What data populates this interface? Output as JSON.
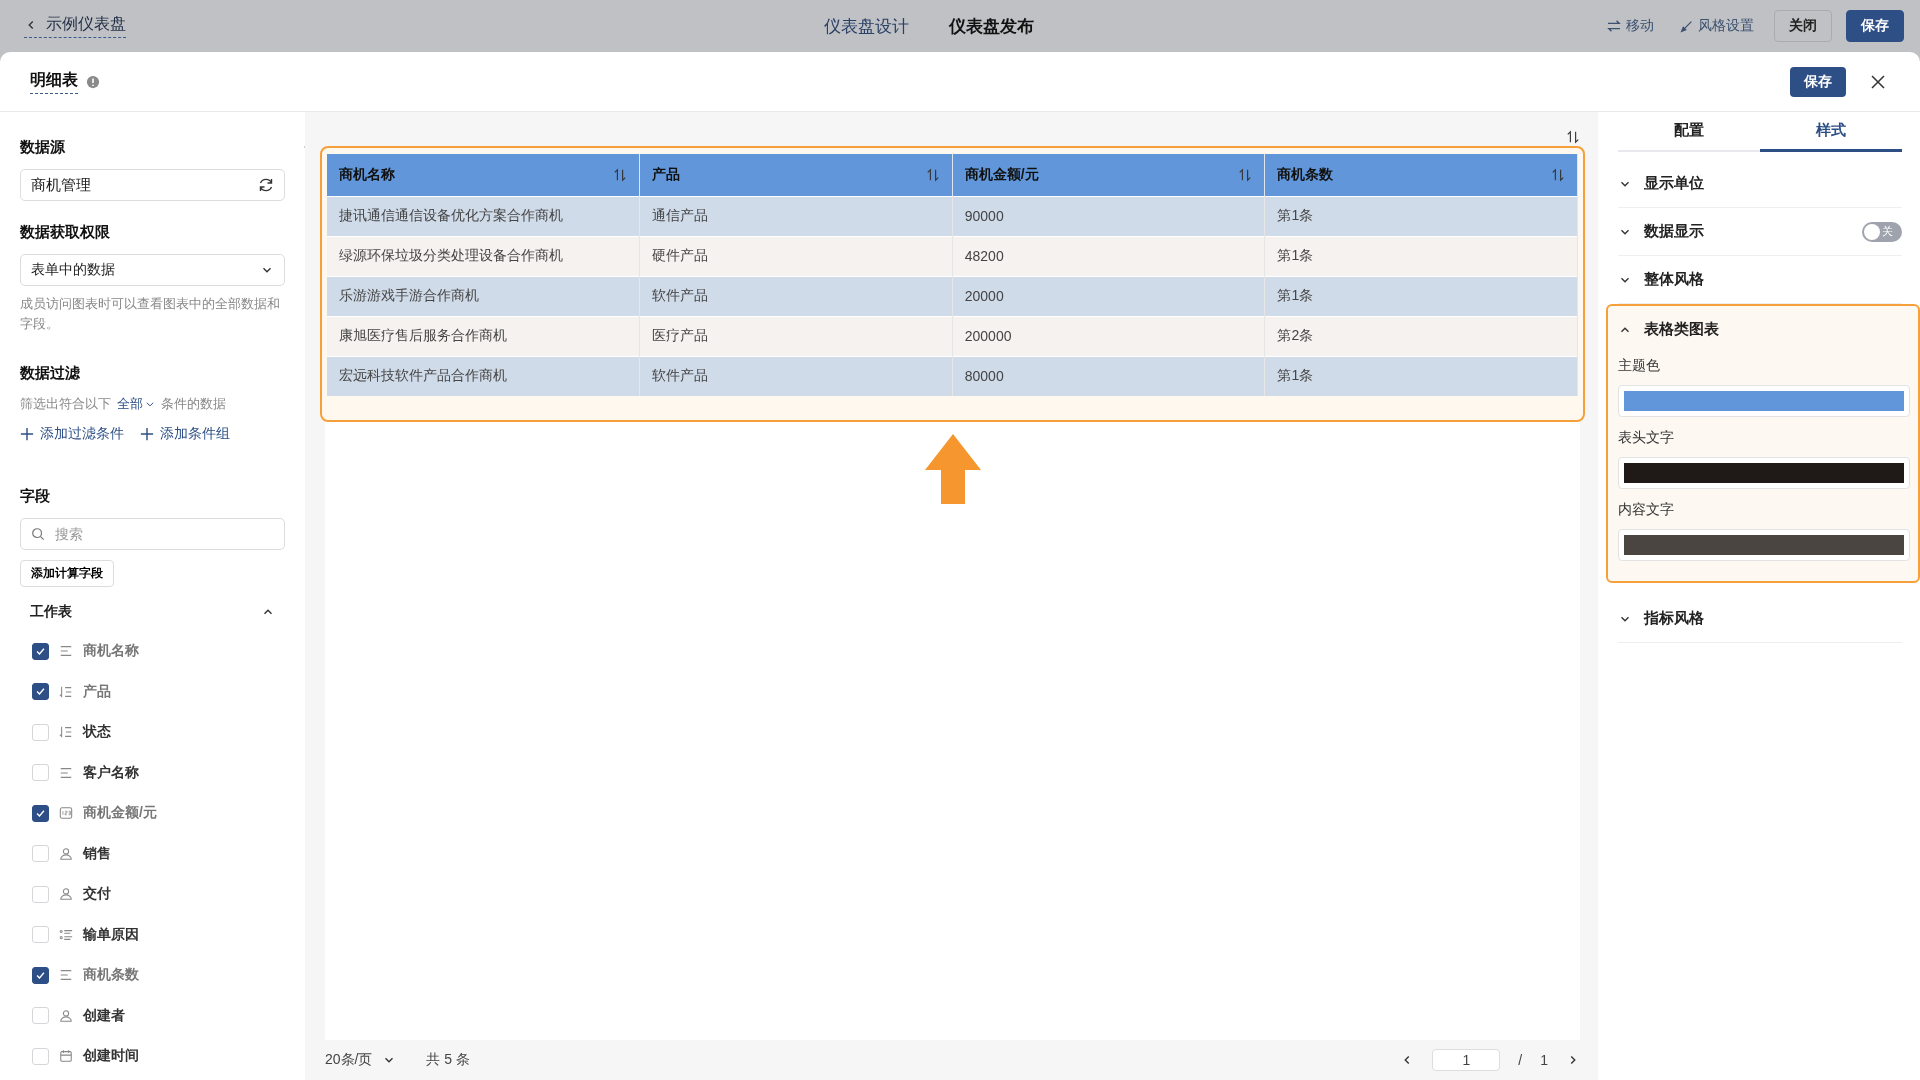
{
  "topbar": {
    "back": "示例仪表盘",
    "tabs": [
      {
        "label": "仪表盘设计",
        "selected": false
      },
      {
        "label": "仪表盘发布",
        "selected": true
      }
    ],
    "actions": [
      {
        "kind": "move",
        "label": "移动"
      },
      {
        "kind": "style",
        "label": "风格设置"
      },
      {
        "kind": "outline",
        "label": "关闭"
      },
      {
        "kind": "primary",
        "label": "保存"
      }
    ]
  },
  "dialog": {
    "title": "明细表",
    "save": "保存"
  },
  "left": {
    "source": {
      "title": "数据源",
      "value": "商机管理"
    },
    "permission": {
      "title": "数据获取权限",
      "value": "表单中的数据",
      "hint": "成员访问图表时可以查看图表中的全部数据和字段。"
    },
    "filter": {
      "title": "数据过滤",
      "prefix": "筛选出符合以下",
      "mode": "全部",
      "suffix": "条件的数据",
      "add_condition": "添加过滤条件",
      "add_group": "添加条件组"
    },
    "fields": {
      "title": "字段",
      "placeholder": "搜索",
      "add_calc": "添加计算字段",
      "group": "工作表",
      "expanded": true,
      "items": [
        {
          "label": "商机名称",
          "kind": "text",
          "checked": true
        },
        {
          "label": "产品",
          "kind": "select",
          "checked": true
        },
        {
          "label": "状态",
          "kind": "select",
          "checked": false
        },
        {
          "label": "客户名称",
          "kind": "text",
          "checked": false
        },
        {
          "label": "商机金额/元",
          "kind": "number",
          "checked": true
        },
        {
          "label": "销售",
          "kind": "person",
          "checked": false
        },
        {
          "label": "交付",
          "kind": "person",
          "checked": false
        },
        {
          "label": "输单原因",
          "kind": "list",
          "checked": false
        },
        {
          "label": "商机条数",
          "kind": "text",
          "checked": true
        },
        {
          "label": "创建者",
          "kind": "person",
          "checked": false
        },
        {
          "label": "创建时间",
          "kind": "date",
          "checked": false
        }
      ]
    }
  },
  "table": {
    "columns": [
      "商机名称",
      "产品",
      "商机金额/元",
      "商机条数"
    ],
    "rows": [
      [
        "捷讯通信通信设备优化方案合作商机",
        "通信产品",
        "90000",
        "第1条"
      ],
      [
        "绿源环保垃圾分类处理设备合作商机",
        "硬件产品",
        "48200",
        "第1条"
      ],
      [
        "乐游游戏手游合作商机",
        "软件产品",
        "20000",
        "第1条"
      ],
      [
        "康旭医疗售后服务合作商机",
        "医疗产品",
        "200000",
        "第2条"
      ],
      [
        "宏远科技软件产品合作商机",
        "软件产品",
        "80000",
        "第1条"
      ]
    ],
    "page_size": "20条/页",
    "total": "共 5 条",
    "page": "1",
    "separator": "/",
    "pages": "1"
  },
  "right": {
    "tabs": [
      {
        "label": "配置",
        "selected": false
      },
      {
        "label": "样式",
        "selected": true
      }
    ],
    "sections": [
      {
        "label": "显示单位",
        "expanded": false
      },
      {
        "label": "数据显示",
        "expanded": false,
        "toggle": {
          "label": "关",
          "on": false
        }
      },
      {
        "label": "整体风格",
        "expanded": false
      },
      {
        "label": "表格类图表",
        "expanded": true,
        "highlight": true,
        "colors": [
          {
            "label": "主题色",
            "color": "#6197da"
          },
          {
            "label": "表头文字",
            "color": "#1f1a17"
          },
          {
            "label": "内容文字",
            "color": "#4a4540"
          }
        ]
      },
      {
        "label": "指标风格",
        "expanded": false
      }
    ]
  }
}
